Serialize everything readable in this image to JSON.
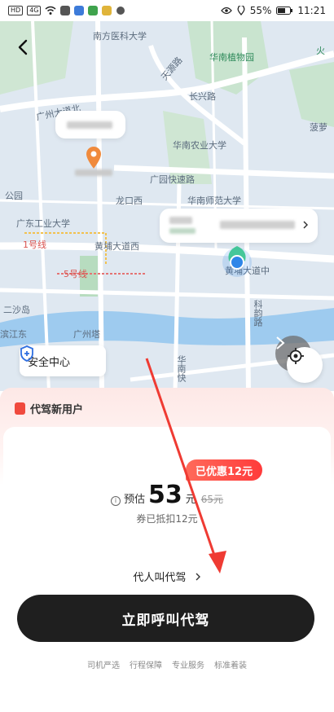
{
  "status_bar": {
    "left_chips": [
      "HD",
      "4G"
    ],
    "battery": "55%",
    "time": "11:21"
  },
  "map": {
    "labels": [
      {
        "text": "南方医科大学",
        "cls": ""
      },
      {
        "text": "华南植物园",
        "cls": "green"
      },
      {
        "text": "火",
        "cls": "green"
      },
      {
        "text": "天源路",
        "cls": ""
      },
      {
        "text": "长兴路",
        "cls": ""
      },
      {
        "text": "广州大道北",
        "cls": ""
      },
      {
        "text": "华南农业大学",
        "cls": ""
      },
      {
        "text": "菠萝",
        "cls": ""
      },
      {
        "text": "广园快速路",
        "cls": ""
      },
      {
        "text": "龙口西",
        "cls": ""
      },
      {
        "text": "华南师范大学",
        "cls": ""
      },
      {
        "text": "公园",
        "cls": ""
      },
      {
        "text": "广东工业大学",
        "cls": ""
      },
      {
        "text": "1号线",
        "cls": "red"
      },
      {
        "text": "黄埔大道西",
        "cls": ""
      },
      {
        "text": "黄埔大道中",
        "cls": ""
      },
      {
        "text": "5号线",
        "cls": "red"
      },
      {
        "text": "二沙岛",
        "cls": ""
      },
      {
        "text": "广州塔",
        "cls": ""
      },
      {
        "text": "科韵路",
        "cls": ""
      },
      {
        "text": "滨江东",
        "cls": ""
      },
      {
        "text": "华南快",
        "cls": ""
      }
    ],
    "safety_center": "安全中心"
  },
  "panel": {
    "promo_tag": "代驾新用户",
    "discount_badge": "已优惠12元",
    "estimate_label": "预估",
    "price": "53",
    "unit": "元",
    "original_price": "65元",
    "coupon_text": "券已抵扣12元",
    "proxy_call": "代人叫代驾",
    "call_button": "立即呼叫代驾",
    "features": [
      "司机严选",
      "行程保障",
      "专业服务",
      "标准着装"
    ]
  },
  "colors": {
    "accent_red": "#ff3b3b",
    "button_dark": "#1f1f1f",
    "map_bg": "#dfe8f1",
    "location_blue": "#2f86e8",
    "pin_orange": "#f08a3c"
  }
}
